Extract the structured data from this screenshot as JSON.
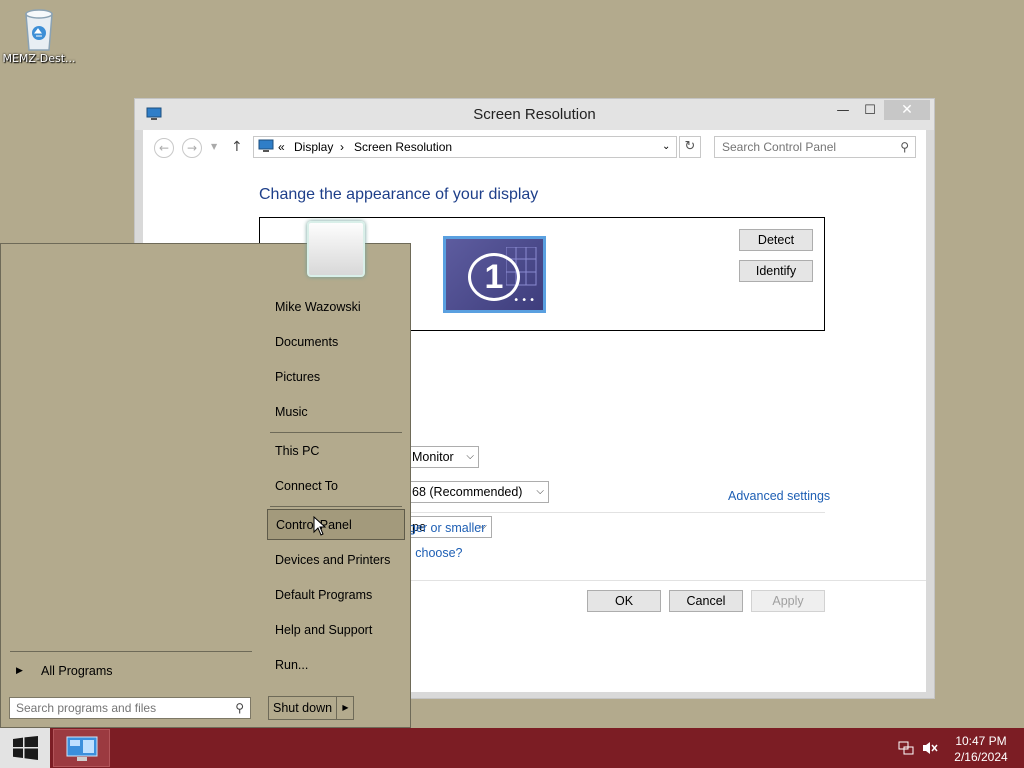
{
  "desktop": {
    "icons": [
      {
        "label": "MEMZ-Dest..."
      }
    ]
  },
  "window": {
    "title": "Screen Resolution",
    "minimize": "—",
    "maximize": "☐",
    "close": "✕",
    "address": {
      "overflow": "«",
      "crumb1": "Display",
      "sep": "›",
      "crumb2": "Screen Resolution"
    },
    "search_placeholder": "Search Control Panel",
    "heading": "Change the appearance of your display",
    "monitor_number": "1",
    "detect": "Detect",
    "identify": "Identify",
    "display_value": "Monitor",
    "resolution_value": "68 (Recommended)",
    "orientation_value": "pe",
    "advanced": "Advanced settings",
    "link_larger": "ger or smaller",
    "link_choose": "l choose?",
    "ok": "OK",
    "cancel": "Cancel",
    "apply": "Apply"
  },
  "start_menu": {
    "items": [
      {
        "label": "Mike Wazowski"
      },
      {
        "label": "Documents"
      },
      {
        "label": "Pictures"
      },
      {
        "label": "Music"
      },
      {
        "label": "This PC"
      },
      {
        "label": "Connect To"
      },
      {
        "label": "Control Panel",
        "highlighted": true
      },
      {
        "label": "Devices and Printers"
      },
      {
        "label": "Default Programs"
      },
      {
        "label": "Help and Support"
      },
      {
        "label": "Run..."
      }
    ],
    "all_programs": "All Programs",
    "search_placeholder": "Search programs and files",
    "shutdown": "Shut down"
  },
  "taskbar": {
    "time": "10:47 PM",
    "date": "2/16/2024"
  },
  "colors": {
    "desktop": "#b3aa8d",
    "taskbar": "#7c1d24",
    "link": "#1e5fb4",
    "heading": "#1e3f8a"
  }
}
